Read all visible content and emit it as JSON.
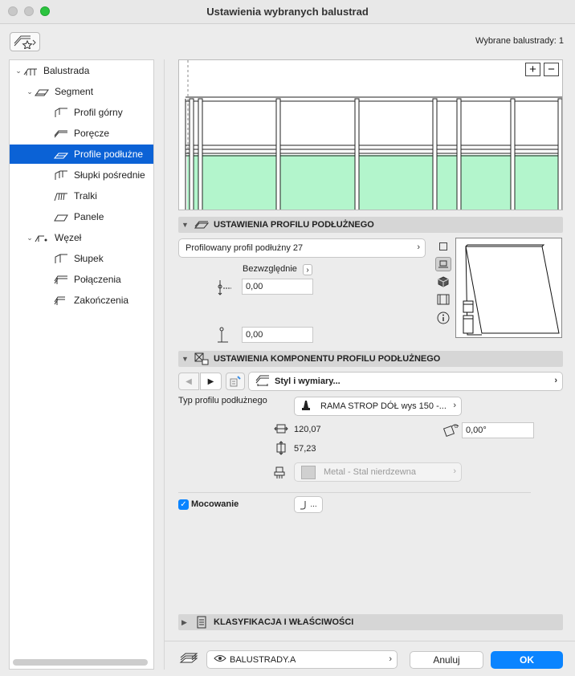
{
  "window": {
    "title": "Ustawienia wybranych balustrad"
  },
  "header": {
    "selected_count": "Wybrane balustrady: 1"
  },
  "tree": {
    "items": [
      {
        "label": "Balustrada",
        "level": 0,
        "expand": "open"
      },
      {
        "label": "Segment",
        "level": 1,
        "expand": "open"
      },
      {
        "label": "Profil górny",
        "level": 2
      },
      {
        "label": "Poręcze",
        "level": 2
      },
      {
        "label": "Profile podłużne",
        "level": 2,
        "selected": true
      },
      {
        "label": "Słupki pośrednie",
        "level": 2
      },
      {
        "label": "Tralki",
        "level": 2
      },
      {
        "label": "Panele",
        "level": 2
      },
      {
        "label": "Węzeł",
        "level": 1,
        "expand": "open"
      },
      {
        "label": "Słupek",
        "level": 2
      },
      {
        "label": "Połączenia",
        "level": 2
      },
      {
        "label": "Zakończenia",
        "level": 2
      }
    ]
  },
  "preview": {
    "zoom_in": "+",
    "zoom_out": "−"
  },
  "profile_settings": {
    "header": "USTAWIENIA PROFILU PODŁUŻNEGO",
    "profile_select": "Profilowany profil podłużny 27",
    "mode_label": "Bezwzględnie",
    "offset_value": "0,00",
    "height_value": "0,00"
  },
  "component_settings": {
    "header": "USTAWIENIA KOMPONENTU PROFILU PODŁUŻNEGO",
    "style_select": "Styl i wymiary...",
    "type_label": "Typ profilu podłużnego",
    "type_value": "RAMA STROP DÓŁ wys 150 -...",
    "width_value": "120,07",
    "height_value": "57,23",
    "angle_value": "0,00°",
    "material_value": "Metal - Stal nierdzewna",
    "mounting_label": "Mocowanie",
    "mounting_checked": true,
    "mounting_button": "..."
  },
  "classification": {
    "header": "KLASYFIKACJA I WŁAŚCIWOŚCI"
  },
  "footer": {
    "layer_value": "BALUSTRADY.A",
    "cancel_label": "Anuluj",
    "ok_label": "OK"
  },
  "colors": {
    "accent": "#0b62d6",
    "ok_button": "#0a84ff",
    "panel_fill": "#b3f5cc"
  }
}
